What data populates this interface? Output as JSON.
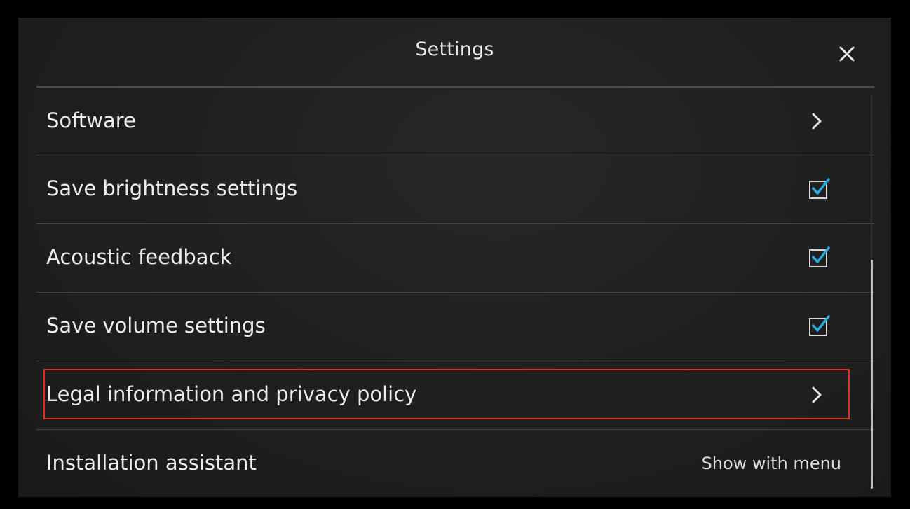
{
  "header": {
    "title": "Settings",
    "close_icon": "close-icon"
  },
  "list": {
    "items": [
      {
        "label": "Software",
        "control": "chevron",
        "icon": "chevron-right-icon"
      },
      {
        "label": "Save brightness settings",
        "control": "checkbox",
        "checked": true,
        "icon": "checkbox-checked-icon"
      },
      {
        "label": "Acoustic feedback",
        "control": "checkbox",
        "checked": true,
        "icon": "checkbox-checked-icon"
      },
      {
        "label": "Save volume settings",
        "control": "checkbox",
        "checked": true,
        "icon": "checkbox-checked-icon"
      },
      {
        "label": "Legal information and privacy policy",
        "control": "chevron",
        "icon": "chevron-right-icon",
        "highlighted": true
      },
      {
        "label": "Installation assistant",
        "control": "text",
        "value": "Show with menu"
      }
    ]
  },
  "colors": {
    "background": "#1f1f1f",
    "text": "#ececec",
    "checkmark": "#29a8e0",
    "highlight_border": "#e0301e",
    "divider": "#444444"
  }
}
